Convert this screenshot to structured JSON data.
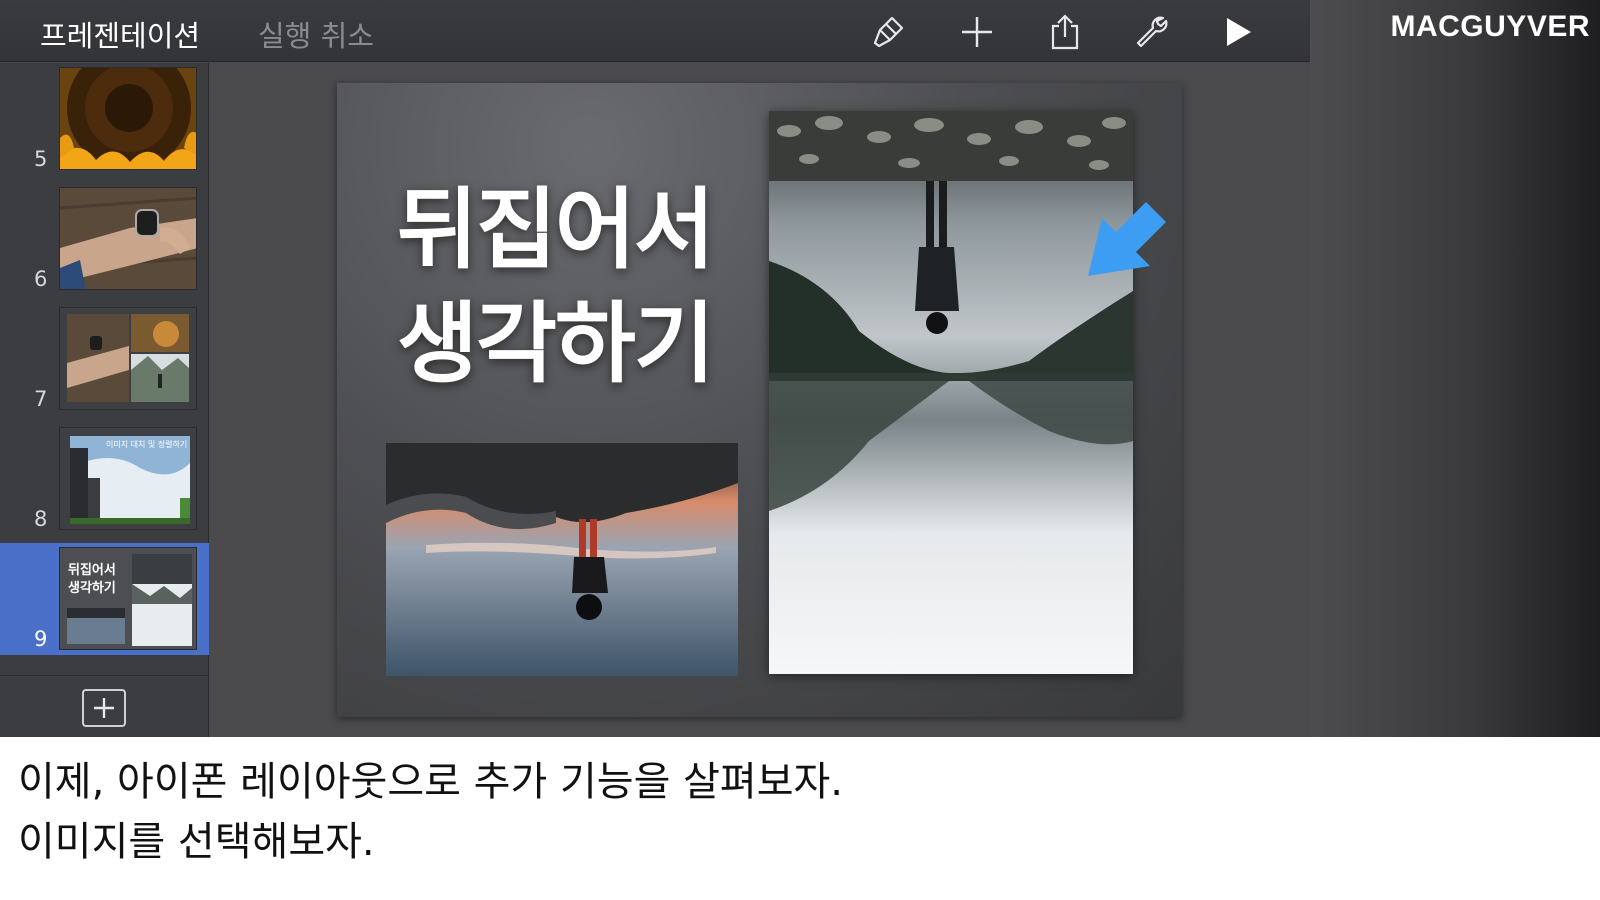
{
  "toolbar": {
    "title": "프레젠테이션",
    "undo_label": "실행 취소",
    "icons": [
      "paintbrush-icon",
      "plus-icon",
      "share-icon",
      "wrench-icon",
      "play-icon"
    ]
  },
  "sidebar": {
    "slides": [
      {
        "number": "5"
      },
      {
        "number": "6"
      },
      {
        "number": "7"
      },
      {
        "number": "8",
        "caption": "이미지 대치 및 정렬하기"
      },
      {
        "number": "9",
        "title_line1": "뒤집어서",
        "title_line2": "생각하기",
        "selected": true
      }
    ]
  },
  "slide": {
    "title_line1": "뒤집어서",
    "title_line2": "생각하기"
  },
  "brand": "MACGUYVER",
  "caption": {
    "line1": "이제, 아이폰 레이아웃으로 추가 기능을 살펴보자.",
    "line2": "이미지를 선택해보자."
  },
  "colors": {
    "selection": "#4a6fc8",
    "arrow": "#3d9df2"
  }
}
